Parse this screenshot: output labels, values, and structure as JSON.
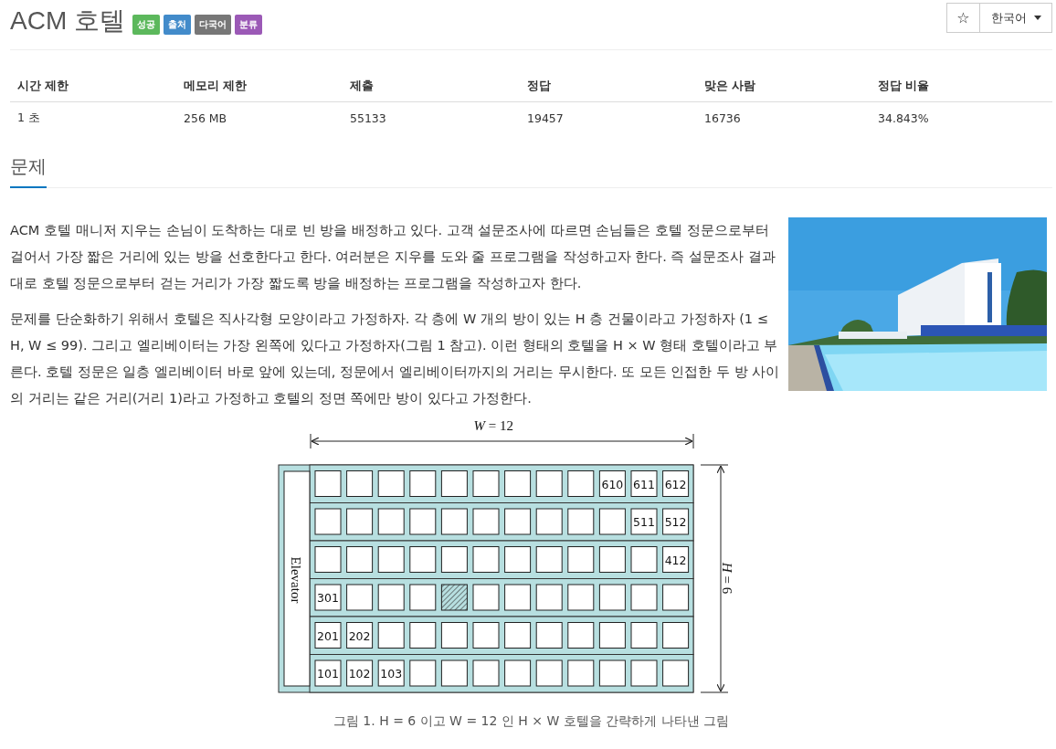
{
  "title": "ACM 호텔",
  "badges": [
    {
      "label": "성공",
      "color": "#5cb85c"
    },
    {
      "label": "출처",
      "color": "#428bca"
    },
    {
      "label": "다국어",
      "color": "#777777"
    },
    {
      "label": "분류",
      "color": "#9b59b6"
    }
  ],
  "star_button": "☆",
  "language": "한국어",
  "stats": {
    "columns": [
      "시간 제한",
      "메모리 제한",
      "제출",
      "정답",
      "맞은 사람",
      "정답 비율"
    ],
    "rows": [
      [
        "1 초",
        "256 MB",
        "55133",
        "19457",
        "16736",
        "34.843%"
      ]
    ]
  },
  "section_title": "문제",
  "paragraphs": [
    "ACM 호텔 매니저 지우는 손님이 도착하는 대로 빈 방을 배정하고 있다. 고객 설문조사에 따르면 손님들은 호텔 정문으로부터 걸어서 가장 짧은 거리에 있는 방을 선호한다고 한다. 여러분은 지우를 도와 줄 프로그램을 작성하고자 한다. 즉 설문조사 결과 대로 호텔 정문으로부터 걷는 거리가 가장 짧도록 방을 배정하는 프로그램을 작성하고자 한다.",
    "문제를 단순화하기 위해서 호텔은 직사각형 모양이라고 가정하자. 각 층에 W 개의 방이 있는 H 층 건물이라고 가정하자 (1 ≤ H, W ≤ 99). 그리고 엘리베이터는 가장 왼쪽에 있다고 가정하자(그림 1 참고). 이런 형태의 호텔을 H × W 형태 호텔이라고 부른다. 호텔 정문은 일층 엘리베이터 바로 앞에 있는데, 정문에서 엘리베이터까지의 거리는 무시한다. 또 모든 인접한 두 방 사이의 거리는 같은 거리(거리 1)라고 가정하고 호텔의 정면 쪽에만 방이 있다고 가정한다."
  ],
  "figure": {
    "width_label": "*W* = 12",
    "height_label": "*H* = 6",
    "elevator": "Elevator",
    "floors": [
      [
        {
          "kind": "empty"
        },
        {
          "kind": "empty"
        },
        {
          "kind": "empty"
        },
        {
          "kind": "empty"
        },
        {
          "kind": "empty"
        },
        {
          "kind": "empty"
        },
        {
          "kind": "empty"
        },
        {
          "kind": "empty"
        },
        {
          "kind": "empty"
        },
        {
          "kind": "numbered",
          "label": "610"
        },
        {
          "kind": "numbered",
          "label": "611"
        },
        {
          "kind": "numbered",
          "label": "612"
        }
      ],
      [
        {
          "kind": "empty"
        },
        {
          "kind": "empty"
        },
        {
          "kind": "empty"
        },
        {
          "kind": "empty"
        },
        {
          "kind": "empty"
        },
        {
          "kind": "empty"
        },
        {
          "kind": "empty"
        },
        {
          "kind": "empty"
        },
        {
          "kind": "empty"
        },
        {
          "kind": "empty"
        },
        {
          "kind": "numbered",
          "label": "511"
        },
        {
          "kind": "numbered",
          "label": "512"
        }
      ],
      [
        {
          "kind": "empty"
        },
        {
          "kind": "empty"
        },
        {
          "kind": "empty"
        },
        {
          "kind": "empty"
        },
        {
          "kind": "empty"
        },
        {
          "kind": "empty"
        },
        {
          "kind": "empty"
        },
        {
          "kind": "empty"
        },
        {
          "kind": "empty"
        },
        {
          "kind": "empty"
        },
        {
          "kind": "empty"
        },
        {
          "kind": "numbered",
          "label": "412"
        }
      ],
      [
        {
          "kind": "numbered",
          "label": "301"
        },
        {
          "kind": "empty"
        },
        {
          "kind": "empty"
        },
        {
          "kind": "empty"
        },
        {
          "kind": "hatched"
        },
        {
          "kind": "empty"
        },
        {
          "kind": "empty"
        },
        {
          "kind": "empty"
        },
        {
          "kind": "empty"
        },
        {
          "kind": "empty"
        },
        {
          "kind": "empty"
        },
        {
          "kind": "empty"
        }
      ],
      [
        {
          "kind": "numbered",
          "label": "201"
        },
        {
          "kind": "numbered",
          "label": "202"
        },
        {
          "kind": "empty"
        },
        {
          "kind": "empty"
        },
        {
          "kind": "empty"
        },
        {
          "kind": "empty"
        },
        {
          "kind": "empty"
        },
        {
          "kind": "empty"
        },
        {
          "kind": "empty"
        },
        {
          "kind": "empty"
        },
        {
          "kind": "empty"
        },
        {
          "kind": "empty"
        }
      ],
      [
        {
          "kind": "numbered",
          "label": "101"
        },
        {
          "kind": "numbered",
          "label": "102"
        },
        {
          "kind": "numbered",
          "label": "103"
        },
        {
          "kind": "empty"
        },
        {
          "kind": "empty"
        },
        {
          "kind": "empty"
        },
        {
          "kind": "empty"
        },
        {
          "kind": "empty"
        },
        {
          "kind": "empty"
        },
        {
          "kind": "empty"
        },
        {
          "kind": "empty"
        },
        {
          "kind": "empty"
        }
      ]
    ],
    "caption": "그림 1. H = 6 이고 W = 12 인 H × W 호텔을 간략하게 나타낸 그림"
  }
}
